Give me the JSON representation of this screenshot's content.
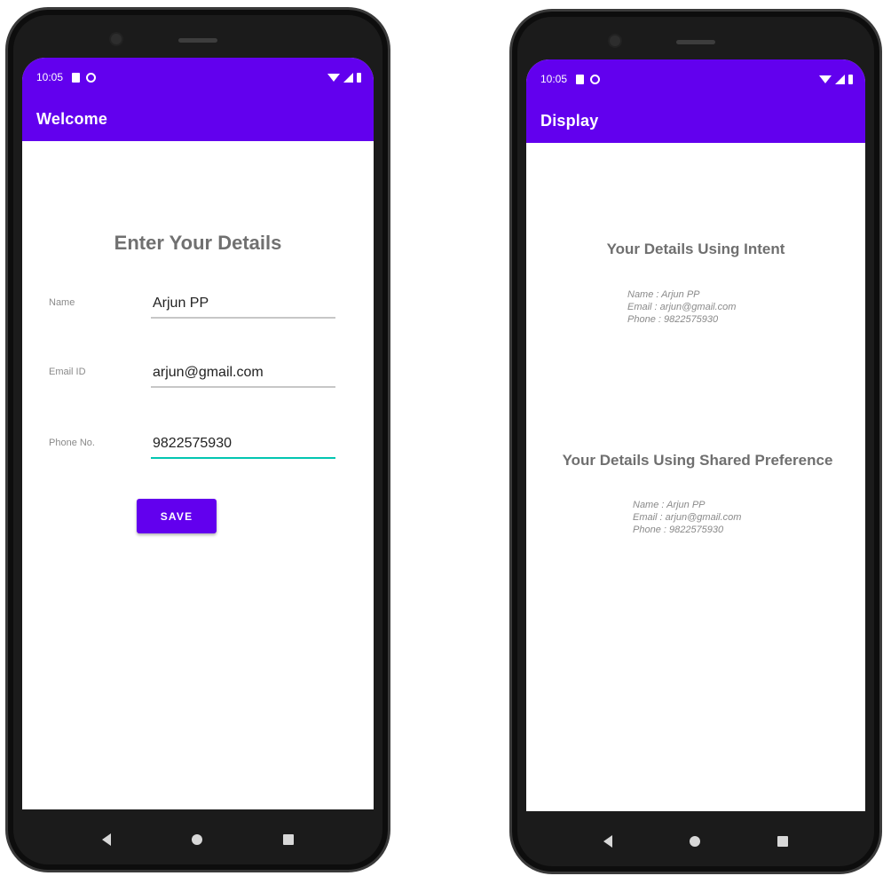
{
  "left_screen": {
    "status": {
      "time": "10:05"
    },
    "appbar_title": "Welcome",
    "form_title": "Enter Your Details",
    "fields": {
      "name": {
        "label": "Name",
        "value": "Arjun PP"
      },
      "email": {
        "label": "Email ID",
        "value": "arjun@gmail.com"
      },
      "phone": {
        "label": "Phone No.",
        "value": "9822575930"
      }
    },
    "save_label": "SAVE"
  },
  "right_screen": {
    "status": {
      "time": "10:05"
    },
    "appbar_title": "Display",
    "intent": {
      "title": "Your Details Using Intent",
      "name_line": "Name : Arjun PP",
      "email_line": "Email : arjun@gmail.com",
      "phone_line": "Phone : 9822575930"
    },
    "pref": {
      "title": "Your Details Using Shared Preference",
      "name_line": "Name : Arjun PP",
      "email_line": "Email : arjun@gmail.com",
      "phone_line": "Phone : 9822575930"
    }
  },
  "colors": {
    "primary": "#6200ee",
    "accent": "#03c6b1",
    "heading": "#707070",
    "muted": "#8a8a8a"
  },
  "icons": {
    "status": [
      "sd-card-icon",
      "at-circle-icon",
      "wifi-icon",
      "signal-icon",
      "battery-icon"
    ],
    "nav": [
      "back-icon",
      "home-icon",
      "recents-icon"
    ]
  }
}
